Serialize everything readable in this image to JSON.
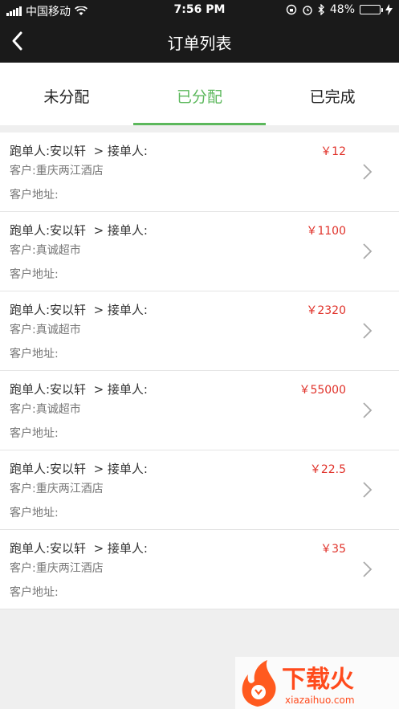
{
  "status_bar": {
    "carrier": "中国移动",
    "time": "7:56 PM",
    "battery": "48%",
    "battery_level": 0.48
  },
  "nav": {
    "title": "订单列表"
  },
  "tabs": [
    {
      "label": "未分配",
      "active": false
    },
    {
      "label": "已分配",
      "active": true
    },
    {
      "label": "已完成",
      "active": false
    }
  ],
  "orders": [
    {
      "runner": "跑单人:安以轩  > 接单人:",
      "price": "￥12",
      "customer": "客户:重庆两江酒店",
      "address": "客户地址:"
    },
    {
      "runner": "跑单人:安以轩  > 接单人:",
      "price": "￥1100",
      "customer": "客户:真诚超市",
      "address": "客户地址:"
    },
    {
      "runner": "跑单人:安以轩  > 接单人:",
      "price": "￥2320",
      "customer": "客户:真诚超市",
      "address": "客户地址:"
    },
    {
      "runner": "跑单人:安以轩  > 接单人:",
      "price": "￥55000",
      "customer": "客户:真诚超市",
      "address": "客户地址:"
    },
    {
      "runner": "跑单人:安以轩  > 接单人:",
      "price": "￥22.5",
      "customer": "客户:重庆两江酒店",
      "address": "客户地址:"
    },
    {
      "runner": "跑单人:安以轩  > 接单人:",
      "price": "￥35",
      "customer": "客户:重庆两江酒店",
      "address": "客户地址:"
    }
  ],
  "watermark": {
    "brand": "下载火",
    "url": "xiazaihuo.com"
  },
  "colors": {
    "accent": "#5cb85c",
    "price": "#e0322a",
    "header": "#1a1a1a"
  }
}
